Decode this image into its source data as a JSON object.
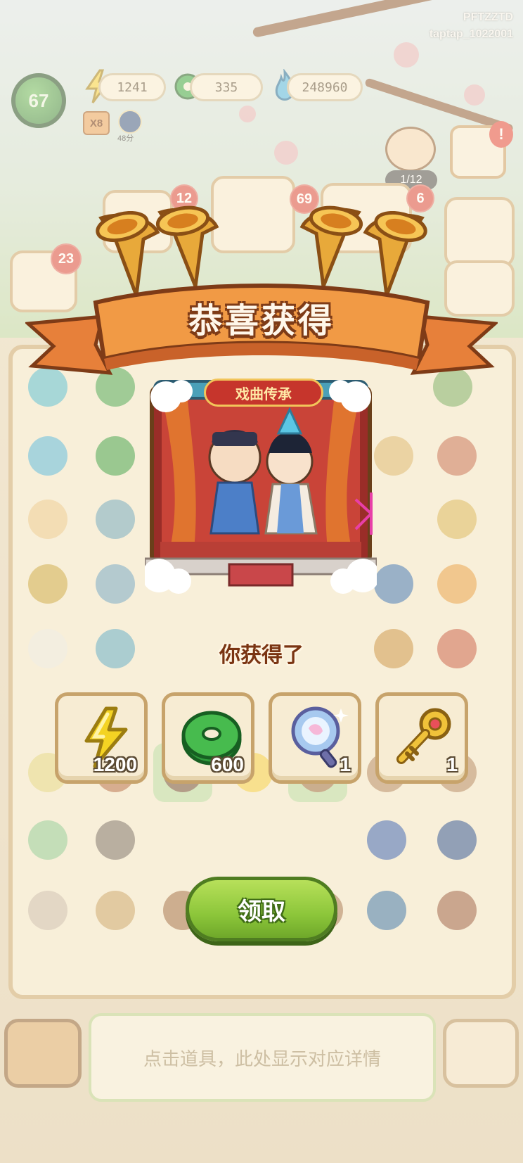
{
  "watermark": {
    "line1": "PFTZZTD",
    "line2": "taptap_1022001"
  },
  "hud": {
    "level": "67",
    "energy": "1241",
    "jade": "335",
    "flame": "248960",
    "multiplier": "X8",
    "timer": "48分",
    "npc_progress": "1/12"
  },
  "order_badges": [
    "12",
    "69",
    "6",
    "23"
  ],
  "modal": {
    "title": "恭喜获得",
    "card_label": "戏曲传承",
    "received_label": "你获得了",
    "rewards": [
      {
        "icon": "lightning-icon",
        "qty": "1200"
      },
      {
        "icon": "jade-coin-icon",
        "qty": "600"
      },
      {
        "icon": "magic-mirror-icon",
        "qty": "1"
      },
      {
        "icon": "golden-key-icon",
        "qty": "1"
      }
    ],
    "claim_button": "领取"
  },
  "info_bar": {
    "hint": "点击道具，此处显示对应详情"
  },
  "colors": {
    "banner": "#f19a45",
    "claim_green": "#8cc63a",
    "card_border": "#c7a36b"
  }
}
